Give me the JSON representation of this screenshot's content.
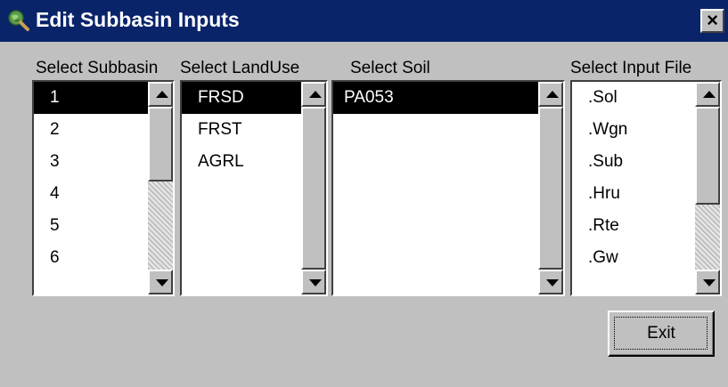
{
  "window": {
    "title": "Edit Subbasin Inputs",
    "title_icon": "globe-magnifier-icon",
    "close_label": "×",
    "colors": {
      "titlebar": "#0a246a",
      "face": "#c0c0c0",
      "selection": "#000000"
    }
  },
  "subbasin": {
    "label": "Select Subbasin",
    "items": [
      "1",
      "2",
      "3",
      "4",
      "5",
      "6"
    ],
    "selected": "1"
  },
  "landuse": {
    "label": "Select LandUse",
    "items": [
      "FRSD",
      "FRST",
      "AGRL"
    ],
    "selected": "FRSD"
  },
  "soil": {
    "label": "Select Soil",
    "items": [
      "PA053"
    ],
    "selected": "PA053"
  },
  "inputfile": {
    "label": "Select Input File",
    "items": [
      ".Sol",
      ".Wgn",
      ".Sub",
      ".Hru",
      ".Rte",
      ".Gw"
    ]
  },
  "exit_label": "Exit"
}
